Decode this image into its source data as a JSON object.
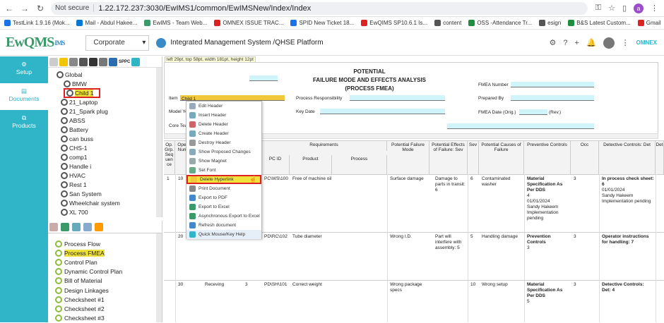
{
  "browser": {
    "not_secure": "Not secure",
    "url": "1.22.172.237:3030/EwIMS1/common/EwIMSNew/Index/Index",
    "avatar_letter": "a"
  },
  "bookmarks": [
    {
      "label": "TestLink 1.9.16 (Mok...",
      "color": "#1a73e8"
    },
    {
      "label": "Mail - Abdul Hakee...",
      "color": "#0078d4"
    },
    {
      "label": "EwIMS - Team Web...",
      "color": "#3a9a6a"
    },
    {
      "label": "OMNEX ISSUE TRAC...",
      "color": "#d22"
    },
    {
      "label": "SPID New Ticket 18...",
      "color": "#1a73e8"
    },
    {
      "label": "EwQIMS SP10.6.1 Is...",
      "color": "#d22"
    },
    {
      "label": "content",
      "color": "#555"
    },
    {
      "label": "OSS -Attendance Tr...",
      "color": "#1e8e3e"
    },
    {
      "label": "esign",
      "color": "#555"
    },
    {
      "label": "B&S Latest Custom...",
      "color": "#1e8e3e"
    },
    {
      "label": "Gmail",
      "color": "#d22"
    }
  ],
  "app": {
    "logo": "EwQMS",
    "logo_ims": "IMS",
    "site_select": "Corporate",
    "title": "Integrated Management System /QHSE Platform",
    "brand_right": "OMNEX"
  },
  "leftnav": [
    {
      "label": "Setup",
      "icon": "gears-icon"
    },
    {
      "label": "Documents",
      "icon": "document-icon"
    },
    {
      "label": "Products",
      "icon": "products-icon"
    }
  ],
  "tree": {
    "root": "Global",
    "items": [
      "BMW",
      "Child 1",
      "21_Laptop",
      "21_Spark plug",
      "ABSS",
      "Battery",
      "can buss",
      "CHS-1",
      "comp1",
      "Handle i",
      "HVAC",
      "Rest 1",
      "San System",
      "Wheelchair system",
      "XL 700"
    ]
  },
  "doc_list": [
    "Process Flow",
    "Process FMEA",
    "Control Plan",
    "Dynamic Control Plan",
    "Bill of Material",
    "Design Linkages",
    "Checksheet #1",
    "Checksheet #2",
    "Checksheet #3"
  ],
  "tooltip": "left 29pt, top 58pt, width 181pt, height 12pt",
  "fmea": {
    "title1": "POTENTIAL",
    "title2": "FAILURE MODE AND EFFECTS ANALYSIS",
    "title3": "(PROCESS FMEA)",
    "item_label": "Item",
    "item_value": "Child 1",
    "model_label": "Model Ye",
    "core_label": "Core Tear",
    "proc_resp": "Process Responsibility",
    "key_date": "Key Date",
    "fmea_number": "FMEA Number",
    "prepared_by": "Prepared By",
    "fmea_date": "FMEA Date (Orig.)",
    "rev": "(Rev.)"
  },
  "grid_headers": {
    "op": "Op. Grp. Seq uen ce",
    "oper": "Oper Num",
    "requirements": "Requirements",
    "pcid": "PC ID",
    "product": "Product",
    "process": "Process",
    "pfm": "Potential Failure Mode",
    "pe": "Potential Effects of Failure: Sev",
    "sev": "Sev",
    "pc": "Potential Causes of Failure",
    "prev": "Preventive Controls",
    "occ": "Occ",
    "det": "Detective Controls: Det",
    "det2": "Det"
  },
  "rows": [
    {
      "op": "1",
      "num": "10",
      "proc": "",
      "n": "",
      "pcid": "PC\\WS\\100",
      "product": "Free of machine oil",
      "process": "",
      "pfm": "Surface damage",
      "pe": "Damage to parts in transit: 6",
      "sev": "6",
      "pc": "Contaminated washer",
      "prev_b": "Material Specification As Per DDS",
      "prev": "4\n01/01/2024\nSandy Hakeem\nImplementation pending",
      "occ": "3",
      "det_b": "In process check sheet: 6",
      "det": "01/01/2024\nSandy Hakeem\nImplementation pending"
    },
    {
      "op": "",
      "num": "20",
      "proc": "",
      "n": "",
      "pcid": "PD\\RC\\102",
      "product": "Tube diameter",
      "process": "",
      "pfm": "Wrong I.D.",
      "pe": "Part will interfere with assembly: 5",
      "sev": "5",
      "pc": "Handling damage",
      "prev_b": "Prevention Controls",
      "prev": "3",
      "occ": "3",
      "det_b": "Operator instructions for handling: 7",
      "det": ""
    },
    {
      "op": "",
      "num": "30",
      "proc": "Receving",
      "n": "3",
      "pcid": "PD\\SH\\101",
      "product": "Correct weight",
      "process": "",
      "pfm": "Wrong package specs",
      "pe": "",
      "sev": "10",
      "pc": "Wrong setup",
      "prev_b": "Material Specification As Per DDS",
      "prev": "5",
      "occ": "3",
      "det_b": "Detective Controls: Det: 4",
      "det": ""
    }
  ],
  "context_menu": [
    "Edit Header",
    "Insert Header",
    "Delete Header",
    "Create Header",
    "Destroy Header",
    "Show Proposed Changes",
    "Show Magnet",
    "Set Font",
    "Delete Hyperlink",
    "Print Document",
    "Export to PDF",
    "Export to Excel",
    "Asynchronous Export to Excel",
    "Refresh document",
    "Quick Mouse/Key Help"
  ]
}
